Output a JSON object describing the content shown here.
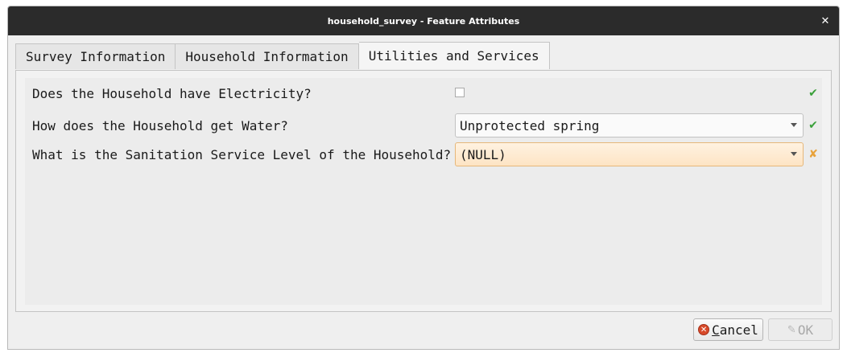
{
  "window": {
    "title": "household_survey - Feature Attributes",
    "close_glyph": "✕"
  },
  "tabs": [
    {
      "label": "Survey Information",
      "active": false
    },
    {
      "label": "Household Information",
      "active": false
    },
    {
      "label": "Utilities and Services",
      "active": true
    }
  ],
  "fields": [
    {
      "label": "Does the Household have Electricity?",
      "widget": "checkbox",
      "checked": false,
      "status_glyph": "✔",
      "status": "valid"
    },
    {
      "label": "How does the Household get Water?",
      "widget": "combobox",
      "value": "Unprotected spring",
      "status_glyph": "✔",
      "status": "valid"
    },
    {
      "label": "What is the Sanitation Service Level of the Household?",
      "widget": "combobox",
      "value": "(NULL)",
      "status_glyph": "✘",
      "status": "invalid"
    }
  ],
  "buttons": {
    "cancel_prefix": "C",
    "cancel_underlined": "ancel",
    "cancel_icon": "✕",
    "ok_label": "OK",
    "ok_icon": "✎",
    "ok_enabled": false
  },
  "colors": {
    "valid": "#3aa03a",
    "invalid": "#e8a23a",
    "null_field_bg": "#fde4c4"
  }
}
